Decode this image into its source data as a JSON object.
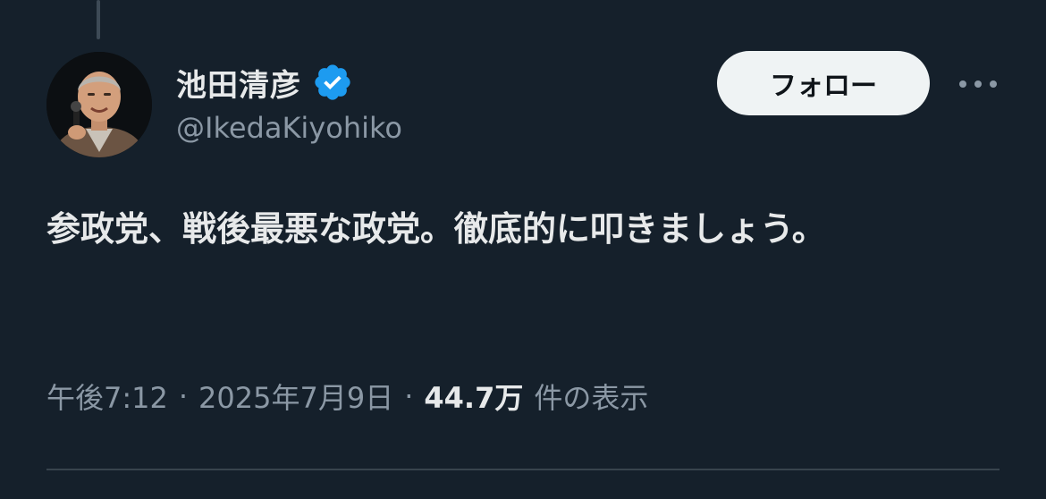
{
  "author": {
    "display_name": "池田清彦",
    "handle": "@IkedaKiyohiko",
    "verified": true,
    "avatar_icon": "avatar-photo"
  },
  "actions": {
    "follow_label": "フォロー",
    "more_icon": "more-icon"
  },
  "tweet": {
    "text": "参政党、戦後最悪な政党。徹底的に叩きましょう。"
  },
  "meta": {
    "time": "午後7:12",
    "separator": "·",
    "date": "2025年7月9日",
    "views_count": "44.7万",
    "views_label": "件の表示"
  },
  "colors": {
    "background": "#15202b",
    "primary_text": "#e7e9ea",
    "secondary_text": "#8b98a5",
    "verified_blue": "#1d9bf0",
    "follow_button_bg": "#eff3f4",
    "follow_button_text": "#0f1419"
  }
}
